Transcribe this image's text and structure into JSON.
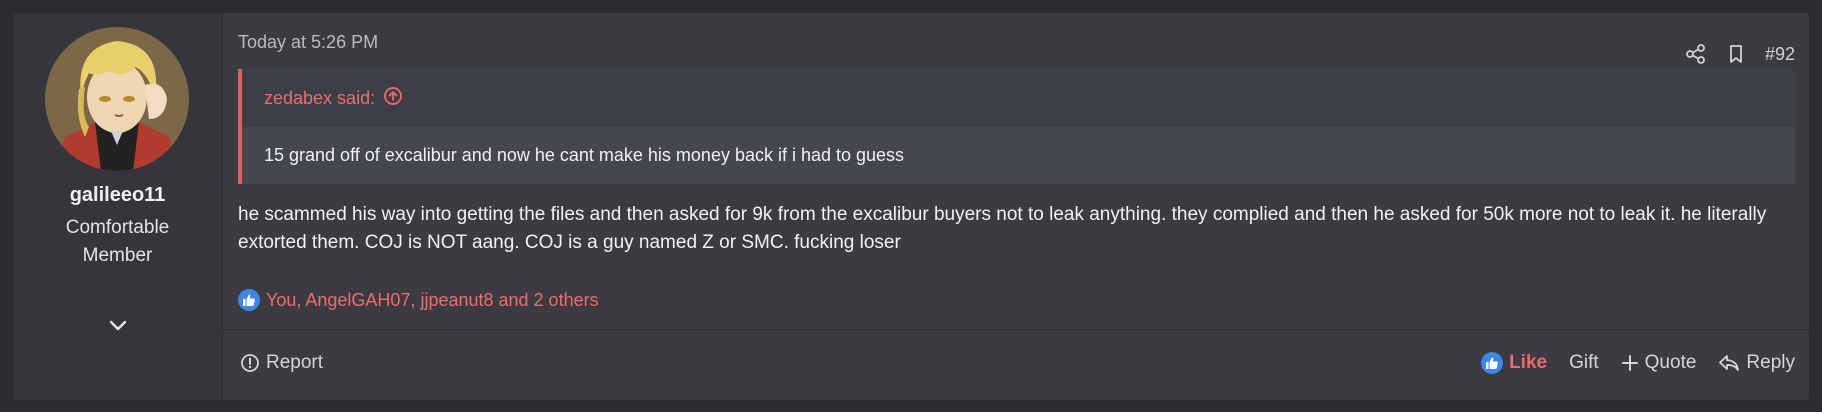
{
  "user": {
    "name": "galileeo11",
    "title": "Comfortable Member"
  },
  "post": {
    "timestamp": "Today at 5:26 PM",
    "number": "#92",
    "quote": {
      "author_line": "zedabex said:",
      "text": "15 grand off of excalibur and now he cant make his money back if i had to guess"
    },
    "message": "he scammed his way into getting the files and then asked for 9k from the excalibur buyers not to leak anything. they complied and then he asked for 50k more not to leak it. he literally extorted them. COJ is NOT aang. COJ is a guy named Z or SMC. fucking loser",
    "reactions_text": "You, AngelGAH07, jjpeanut8 and 2 others"
  },
  "footer": {
    "report_label": "Report",
    "like_label": "Like",
    "gift_label": "Gift",
    "quote_label": "Quote",
    "reply_label": "Reply"
  },
  "icons": {
    "share": "share-icon",
    "bookmark": "bookmark-icon",
    "expand": "chevron-down-icon",
    "quote_jump": "arrow-up-circle-icon",
    "report": "alert-circle-icon",
    "like": "thumbs-up-icon",
    "quote": "plus-icon",
    "reply": "reply-icon"
  },
  "colors": {
    "accent": "#ef6b6b",
    "like_blue": "#3d87e6",
    "panel": "#3a3c42",
    "background": "#2b2d33"
  }
}
